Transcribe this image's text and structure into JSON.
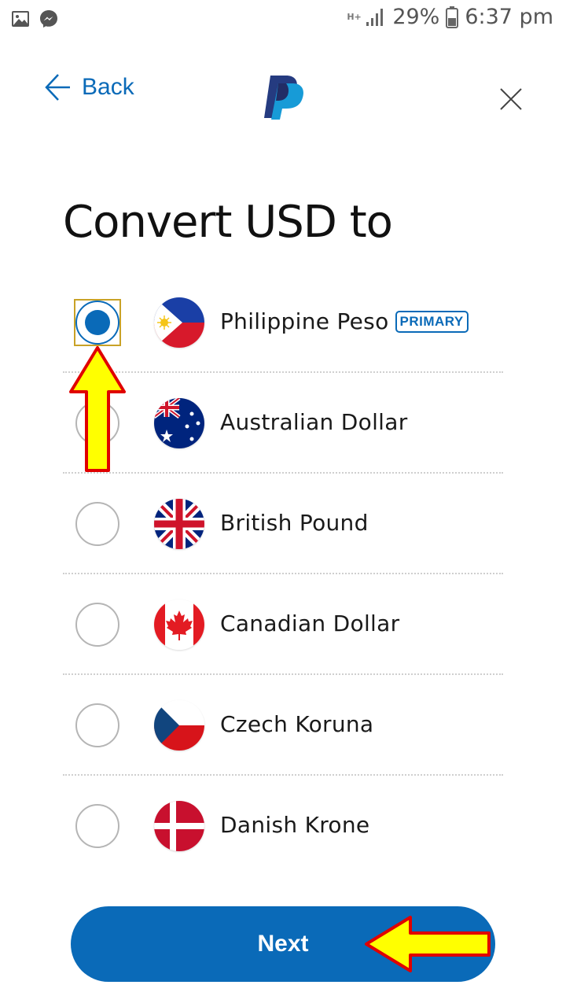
{
  "status_bar": {
    "network": "H+",
    "battery": "29%",
    "time": "6:37 pm"
  },
  "header": {
    "back_label": "Back",
    "logo": "paypal-logo",
    "close_icon": "close-icon"
  },
  "title": "Convert USD to",
  "currencies": [
    {
      "name": "Philippine Peso",
      "badge": "PRIMARY",
      "selected": true,
      "flag": "philippines-flag"
    },
    {
      "name": "Australian Dollar",
      "selected": false,
      "flag": "australia-flag"
    },
    {
      "name": "British Pound",
      "selected": false,
      "flag": "uk-flag"
    },
    {
      "name": "Canadian Dollar",
      "selected": false,
      "flag": "canada-flag"
    },
    {
      "name": "Czech Koruna",
      "selected": false,
      "flag": "czech-flag"
    },
    {
      "name": "Danish Krone",
      "selected": false,
      "flag": "denmark-flag"
    }
  ],
  "next_label": "Next",
  "colors": {
    "accent": "#0a6ab8",
    "annotation_arrow": "#ffff00",
    "annotation_outline": "#e00000"
  }
}
